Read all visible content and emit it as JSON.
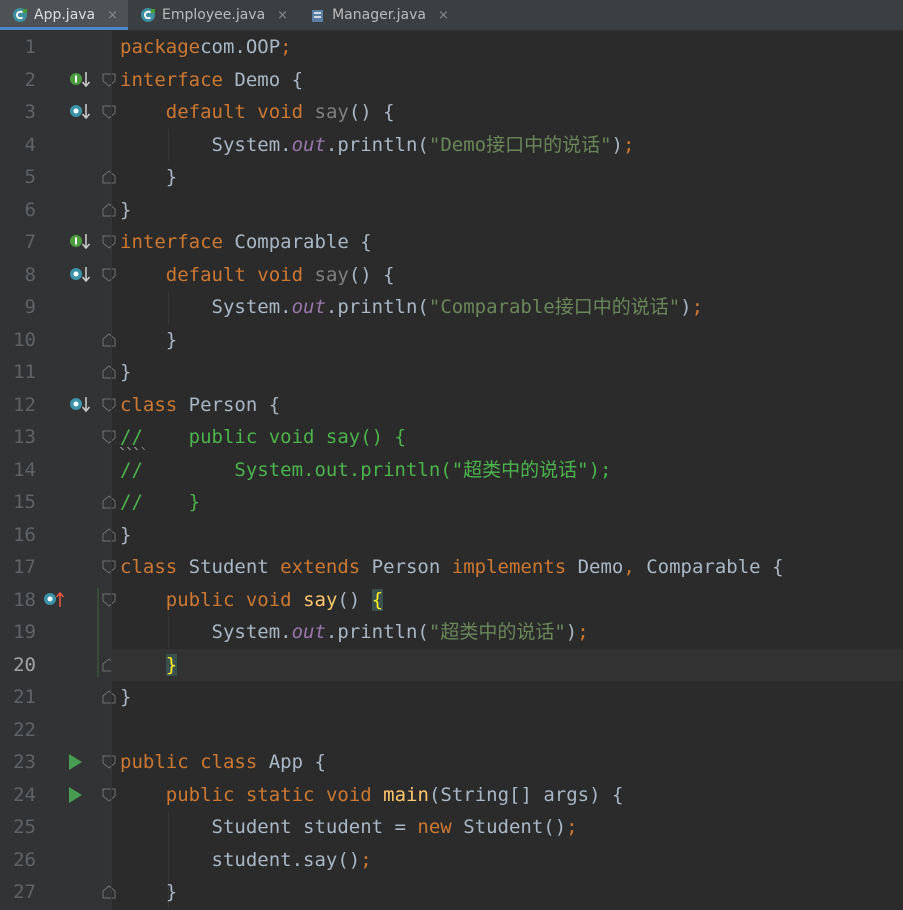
{
  "tabs": [
    {
      "label": "App.java",
      "icon": "java-class-icon",
      "active": true
    },
    {
      "label": "Employee.java",
      "icon": "java-class-icon",
      "active": false
    },
    {
      "label": "Manager.java",
      "icon": "java-file-icon",
      "active": false
    }
  ],
  "tab_close_glyph": "×",
  "colors": {
    "background": "#2b2b2b",
    "gutter": "#313335",
    "keyword": "#cc7832",
    "string": "#6a8759",
    "method": "#ffc66d",
    "comment": "#4cb44c",
    "static_field": "#9876aa",
    "default_text": "#a9b7c6"
  },
  "current_line": 20,
  "lines": [
    {
      "n": "1",
      "tokens": [
        [
          "kw",
          "package"
        ],
        [
          "",
          "com.OOP"
        ],
        [
          "kw",
          ";"
        ]
      ]
    },
    {
      "n": "2",
      "icon": "implemented-interface-icon",
      "tokens": [
        [
          "kw",
          "interface"
        ],
        [
          "",
          " Demo {"
        ]
      ]
    },
    {
      "n": "3",
      "icon": "implemented-method-icon",
      "tokens": [
        [
          "",
          "    "
        ],
        [
          "kw",
          "default"
        ],
        [
          "",
          " "
        ],
        [
          "kw",
          "void"
        ],
        [
          "",
          " "
        ],
        [
          "muted",
          "say"
        ],
        [
          "",
          "() {"
        ]
      ]
    },
    {
      "n": "4",
      "tokens": [
        [
          "",
          "        System."
        ],
        [
          "static",
          "out"
        ],
        [
          "",
          ".println("
        ],
        [
          "str",
          "\"Demo接口中的说话\""
        ],
        [
          "",
          ")"
        ],
        [
          "kw",
          ";"
        ]
      ]
    },
    {
      "n": "5",
      "tokens": [
        [
          "",
          "    }"
        ]
      ]
    },
    {
      "n": "6",
      "tokens": [
        [
          "",
          "}"
        ]
      ]
    },
    {
      "n": "7",
      "icon": "implemented-interface-icon",
      "tokens": [
        [
          "kw",
          "interface"
        ],
        [
          "",
          " Comparable {"
        ]
      ]
    },
    {
      "n": "8",
      "icon": "implemented-method-icon",
      "tokens": [
        [
          "",
          "    "
        ],
        [
          "kw",
          "default"
        ],
        [
          "",
          " "
        ],
        [
          "kw",
          "void"
        ],
        [
          "",
          " "
        ],
        [
          "muted",
          "say"
        ],
        [
          "",
          "() {"
        ]
      ]
    },
    {
      "n": "9",
      "tokens": [
        [
          "",
          "        System."
        ],
        [
          "static",
          "out"
        ],
        [
          "",
          ".println("
        ],
        [
          "str",
          "\"Comparable接口中的说话\""
        ],
        [
          "",
          ")"
        ],
        [
          "kw",
          ";"
        ]
      ]
    },
    {
      "n": "10",
      "tokens": [
        [
          "",
          "    }"
        ]
      ]
    },
    {
      "n": "11",
      "tokens": [
        [
          "",
          "}"
        ]
      ]
    },
    {
      "n": "12",
      "icon": "subclassed-class-icon",
      "tokens": [
        [
          "kw",
          "class"
        ],
        [
          "",
          " Person {"
        ]
      ]
    },
    {
      "n": "13",
      "tokens": [
        [
          "cmt",
          "//    public void say() {"
        ]
      ]
    },
    {
      "n": "14",
      "tokens": [
        [
          "cmt",
          "//        System.out.println(\"超类中的说话\");"
        ]
      ]
    },
    {
      "n": "15",
      "tokens": [
        [
          "cmt",
          "//    }"
        ]
      ]
    },
    {
      "n": "16",
      "tokens": [
        [
          "",
          "}"
        ]
      ]
    },
    {
      "n": "17",
      "tokens": [
        [
          "kw",
          "class"
        ],
        [
          "",
          " Student "
        ],
        [
          "kw",
          "extends"
        ],
        [
          "",
          " Person "
        ],
        [
          "kw",
          "implements"
        ],
        [
          "",
          " Demo"
        ],
        [
          "kw",
          ","
        ],
        [
          "",
          " Comparable {"
        ]
      ]
    },
    {
      "n": "18",
      "icon": "implements-method-icon",
      "tokens": [
        [
          "",
          "    "
        ],
        [
          "kw",
          "public"
        ],
        [
          "",
          " "
        ],
        [
          "kw",
          "void"
        ],
        [
          "",
          " "
        ],
        [
          "fn",
          "say"
        ],
        [
          "",
          "() "
        ],
        [
          "brace",
          "{"
        ]
      ]
    },
    {
      "n": "19",
      "tokens": [
        [
          "",
          "        System."
        ],
        [
          "static",
          "out"
        ],
        [
          "",
          ".println("
        ],
        [
          "str",
          "\"超类中的说话\""
        ],
        [
          "",
          ")"
        ],
        [
          "kw",
          ";"
        ]
      ]
    },
    {
      "n": "20",
      "tokens": [
        [
          "",
          "    "
        ],
        [
          "brace",
          "}"
        ]
      ]
    },
    {
      "n": "21",
      "tokens": [
        [
          "",
          "}"
        ]
      ]
    },
    {
      "n": "22",
      "tokens": []
    },
    {
      "n": "23",
      "icon": "run-icon",
      "tokens": [
        [
          "kw",
          "public"
        ],
        [
          "",
          " "
        ],
        [
          "kw",
          "class"
        ],
        [
          "",
          " App {"
        ]
      ]
    },
    {
      "n": "24",
      "icon": "run-icon",
      "tokens": [
        [
          "",
          "    "
        ],
        [
          "kw",
          "public"
        ],
        [
          "",
          " "
        ],
        [
          "kw",
          "static"
        ],
        [
          "",
          " "
        ],
        [
          "kw",
          "void"
        ],
        [
          "",
          " "
        ],
        [
          "fn",
          "main"
        ],
        [
          "",
          "(String[] args) {"
        ]
      ]
    },
    {
      "n": "25",
      "tokens": [
        [
          "",
          "        Student student = "
        ],
        [
          "kw",
          "new"
        ],
        [
          "",
          " Student()"
        ],
        [
          "kw",
          ";"
        ]
      ]
    },
    {
      "n": "26",
      "tokens": [
        [
          "",
          "        student.say()"
        ],
        [
          "kw",
          ";"
        ]
      ]
    },
    {
      "n": "27",
      "tokens": [
        [
          "",
          "    }"
        ]
      ]
    }
  ]
}
